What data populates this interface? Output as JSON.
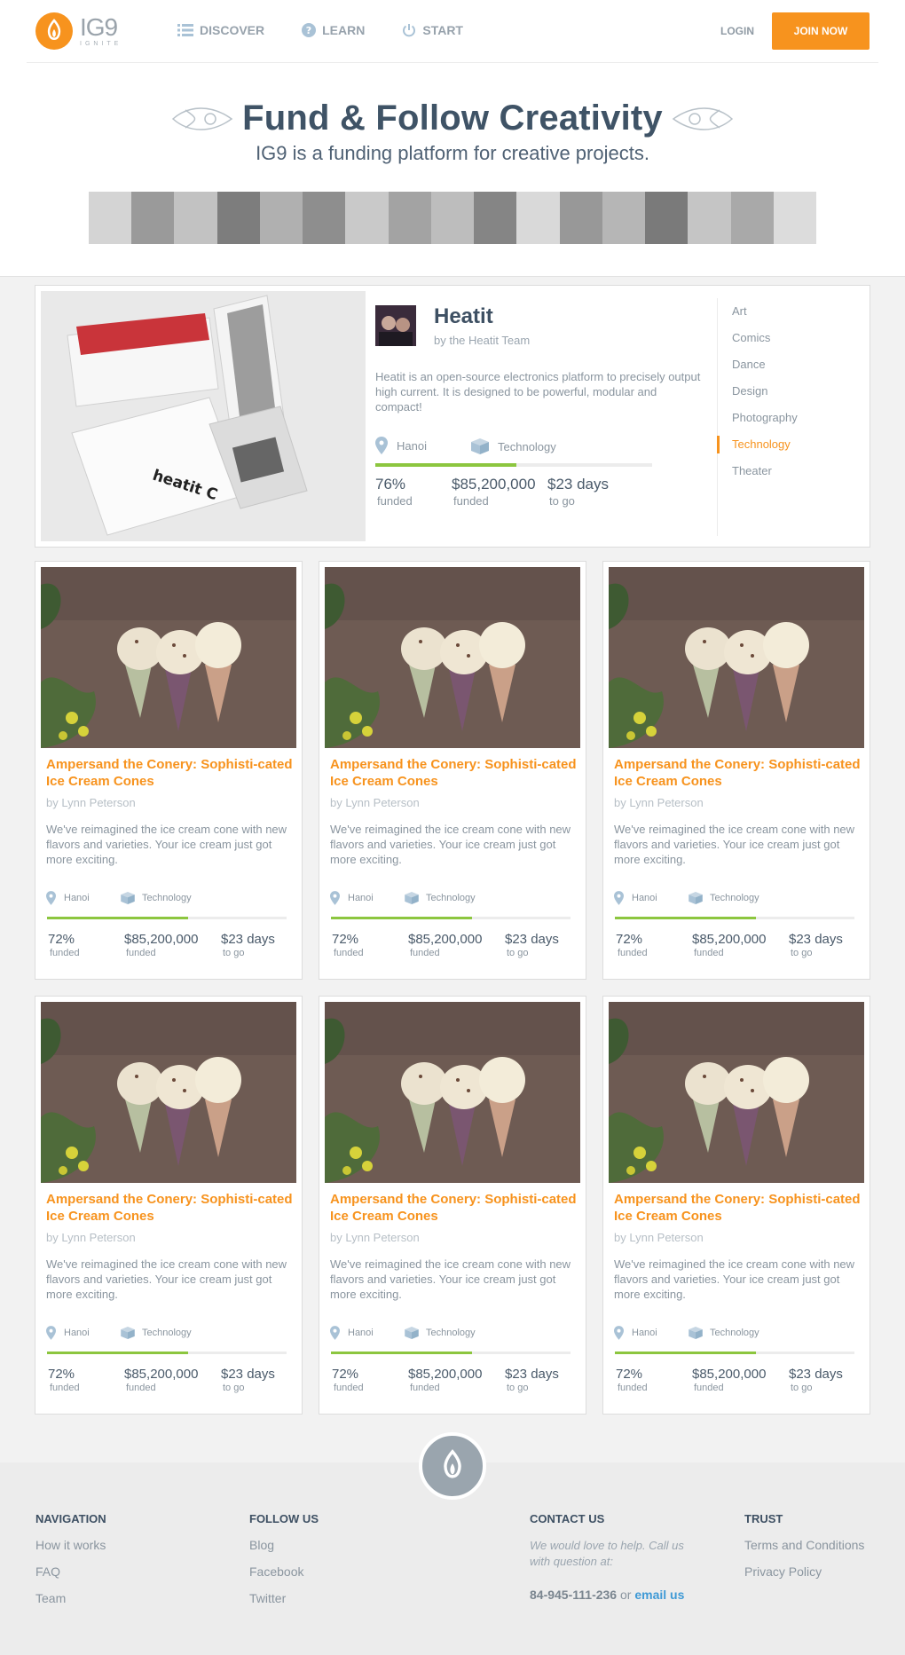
{
  "brand": {
    "name": "IG9",
    "tagline": "IGNITE",
    "accent": "#f7931e",
    "progress_color": "#8cc63f"
  },
  "nav": {
    "items": [
      {
        "label": "DISCOVER",
        "icon": "list-icon"
      },
      {
        "label": "LEARN",
        "icon": "question-icon"
      },
      {
        "label": "START",
        "icon": "power-icon"
      }
    ],
    "login": "LOGIN",
    "join": "JOIN NOW"
  },
  "hero": {
    "title": "Fund & Follow Creativity",
    "subtitle": "IG9 is a funding platform for creative projects."
  },
  "featured": {
    "title": "Heatit",
    "by": "by the Heatit Team",
    "description": "Heatit is an open-source electronics platform to precisely output high current. It is designed to be powerful, modular and compact!",
    "location": "Hanoi",
    "category": "Technology",
    "progress": 0.51,
    "stats": [
      {
        "value": "76%",
        "label": "funded"
      },
      {
        "value": "$85,200,000",
        "label": "funded"
      },
      {
        "value": "$23 days",
        "label": "to go"
      }
    ]
  },
  "categories": {
    "items": [
      "Art",
      "Comics",
      "Dance",
      "Design",
      "Photography",
      "Technology",
      "Theater"
    ],
    "active": "Technology"
  },
  "cards": [
    {
      "title": "Ampersand the Conery: Sophisti-cated Ice Cream Cones",
      "by": "by Lynn Peterson",
      "description": "We've reimagined the ice cream cone with new flavors and varieties. Your ice cream just got more exciting.",
      "location": "Hanoi",
      "category": "Technology",
      "progress": 0.59,
      "stats": [
        {
          "value": "72%",
          "label": "funded"
        },
        {
          "value": "$85,200,000",
          "label": "funded"
        },
        {
          "value": "$23 days",
          "label": "to go"
        }
      ]
    },
    {
      "title": "Ampersand the Conery: Sophisti-cated Ice Cream Cones",
      "by": "by Lynn Peterson",
      "description": "We've reimagined the ice cream cone with new flavors and varieties. Your ice cream just got more exciting.",
      "location": "Hanoi",
      "category": "Technology",
      "progress": 0.59,
      "stats": [
        {
          "value": "72%",
          "label": "funded"
        },
        {
          "value": "$85,200,000",
          "label": "funded"
        },
        {
          "value": "$23 days",
          "label": "to go"
        }
      ]
    },
    {
      "title": "Ampersand the Conery: Sophisti-cated Ice Cream Cones",
      "by": "by Lynn Peterson",
      "description": "We've reimagined the ice cream cone with new flavors and varieties. Your ice cream just got more exciting.",
      "location": "Hanoi",
      "category": "Technology",
      "progress": 0.59,
      "stats": [
        {
          "value": "72%",
          "label": "funded"
        },
        {
          "value": "$85,200,000",
          "label": "funded"
        },
        {
          "value": "$23 days",
          "label": "to go"
        }
      ]
    },
    {
      "title": "Ampersand the Conery: Sophisti-cated Ice Cream Cones",
      "by": "by Lynn Peterson",
      "description": "We've reimagined the ice cream cone with new flavors and varieties. Your ice cream just got more exciting.",
      "location": "Hanoi",
      "category": "Technology",
      "progress": 0.59,
      "stats": [
        {
          "value": "72%",
          "label": "funded"
        },
        {
          "value": "$85,200,000",
          "label": "funded"
        },
        {
          "value": "$23 days",
          "label": "to go"
        }
      ]
    },
    {
      "title": "Ampersand the Conery: Sophisti-cated Ice Cream Cones",
      "by": "by Lynn Peterson",
      "description": "We've reimagined the ice cream cone with new flavors and varieties. Your ice cream just got more exciting.",
      "location": "Hanoi",
      "category": "Technology",
      "progress": 0.59,
      "stats": [
        {
          "value": "72%",
          "label": "funded"
        },
        {
          "value": "$85,200,000",
          "label": "funded"
        },
        {
          "value": "$23 days",
          "label": "to go"
        }
      ]
    },
    {
      "title": "Ampersand the Conery: Sophisti-cated Ice Cream Cones",
      "by": "by Lynn Peterson",
      "description": "We've reimagined the ice cream cone with new flavors and varieties. Your ice cream just got more exciting.",
      "location": "Hanoi",
      "category": "Technology",
      "progress": 0.59,
      "stats": [
        {
          "value": "72%",
          "label": "funded"
        },
        {
          "value": "$85,200,000",
          "label": "funded"
        },
        {
          "value": "$23 days",
          "label": "to go"
        }
      ]
    }
  ],
  "footer": {
    "navigation": {
      "heading": "NAVIGATION",
      "links": [
        "How it works",
        "FAQ",
        "Team"
      ]
    },
    "follow": {
      "heading": "FOLLOW US",
      "links": [
        "Blog",
        "Facebook",
        "Twitter"
      ]
    },
    "contact": {
      "heading": "CONTACT US",
      "note": "We would love to help. Call us with question at:",
      "phone": "84-945-111-236",
      "or": "or",
      "email_label": "email us"
    },
    "trust": {
      "heading": "TRUST",
      "links": [
        "Terms and Conditions",
        "Privacy Policy"
      ]
    }
  }
}
